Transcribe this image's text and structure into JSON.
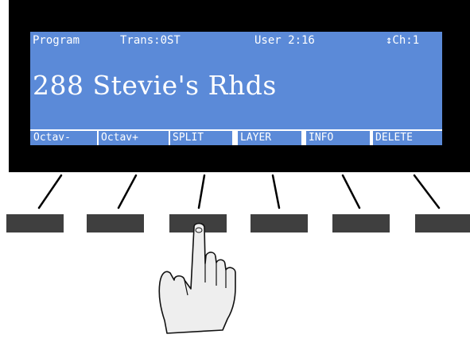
{
  "display": {
    "mode": "Program",
    "transpose": "Trans:0ST",
    "bank": "User 2:16",
    "channel": "↕Ch:1",
    "program_name": "288 Stevie's Rhds",
    "soft_buttons": [
      "Octav-",
      "Octav+",
      "SPLIT",
      "LAYER",
      "INFO",
      "DELETE"
    ]
  },
  "colors": {
    "lcd_background": "#5b8ad8",
    "lcd_text": "#ffffff",
    "bezel": "#000000",
    "button": "#3f3f3f"
  },
  "pressed_button": "SPLIT",
  "icons": {
    "pointer": "hand-pointer-icon"
  }
}
